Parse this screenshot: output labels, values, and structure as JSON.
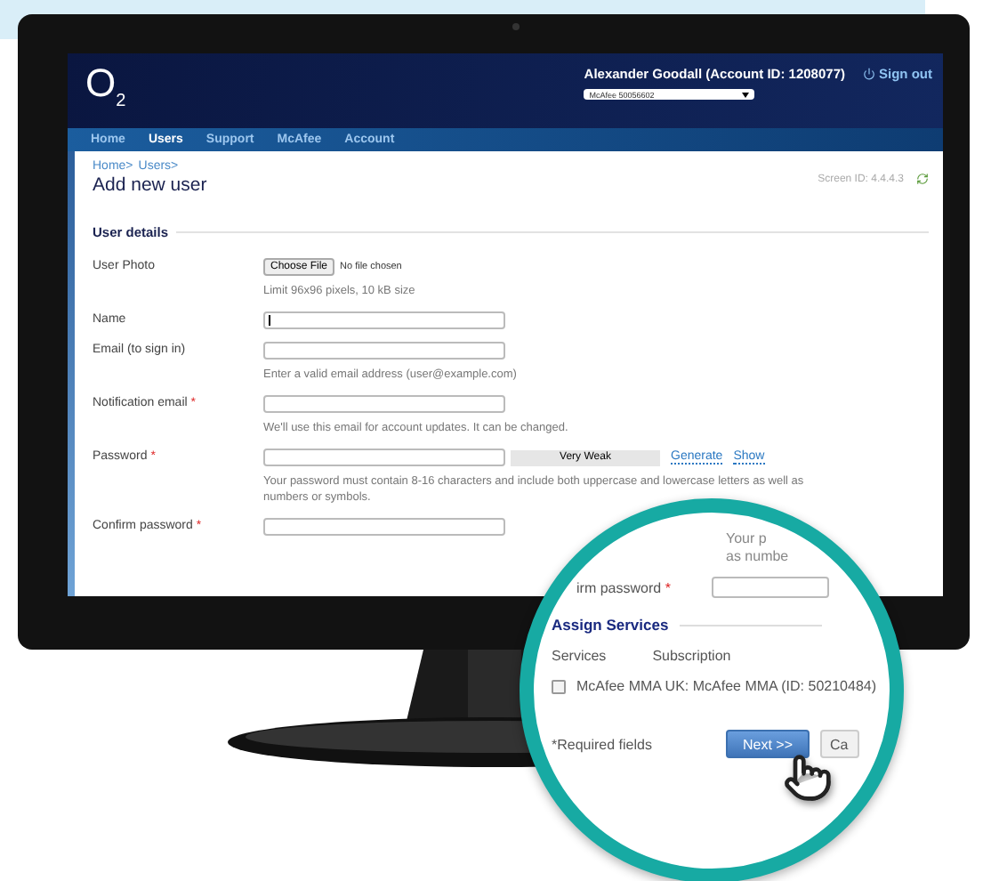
{
  "header": {
    "logo": "O$_{2}$",
    "user": "Alexander Goodall (Account ID: 1208077)",
    "account_select": "McAfee 50056602",
    "sign_out": "Sign out"
  },
  "nav": [
    {
      "label": "Home",
      "selected": false
    },
    {
      "label": "Users",
      "selected": true
    },
    {
      "label": "Support",
      "selected": false
    },
    {
      "label": "McAfee",
      "selected": false
    },
    {
      "label": "Account",
      "selected": false
    }
  ],
  "breadcrumb": [
    "Home>",
    "Users>"
  ],
  "title": "Add new user",
  "screen_id": "Screen ID:  4.4.4.3",
  "section": "User details",
  "rows": [
    {
      "kind": "file",
      "label": "User Photo",
      "button": "Choose File",
      "status": "No file chosen",
      "hint": "Limit 96x96 pixels, 10 kB size"
    },
    {
      "kind": "text",
      "label": "Name",
      "focused": true
    },
    {
      "kind": "text",
      "label": "Email (to sign in)",
      "focused": false,
      "hint": "Enter a valid email address (user@example.com)"
    },
    {
      "kind": "text",
      "label": "Notification email",
      "required": "*",
      "focused": false,
      "hint": "We'll use this email for account updates. It can be changed."
    },
    {
      "kind": "password",
      "label": "Password",
      "required": "*",
      "focused": false,
      "strength": "Very Weak",
      "actions": [
        "Generate",
        "Show"
      ],
      "hint": "Your password must contain 8-16 characters and include both uppercase and lowercase letters as well as numbers or symbols."
    },
    {
      "kind": "text",
      "label": "Confirm password",
      "required": "*",
      "focused": false
    }
  ],
  "magnifier": {
    "fragments": [
      "Your p",
      "as numbe"
    ],
    "confirm_label": "irm password",
    "required": "*",
    "section": "Assign Services",
    "columns": [
      "Services",
      "Subscription"
    ],
    "services": [
      {
        "label": "McAfee MMA UK: McAfee MMA (ID: 50210484)",
        "checked": false
      }
    ],
    "required_note": "*Required fields",
    "buttons": [
      {
        "label": "Next >>",
        "kind": "primary"
      },
      {
        "label": "Ca",
        "kind": "secondary"
      }
    ]
  }
}
